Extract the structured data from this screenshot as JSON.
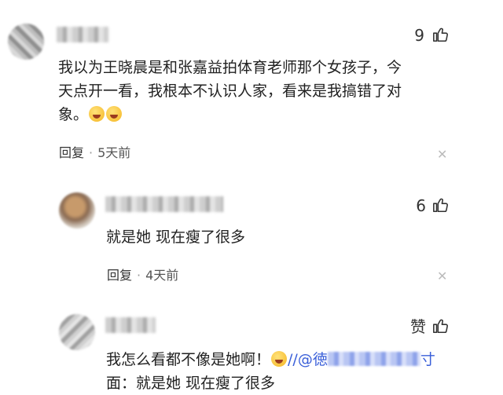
{
  "comments": [
    {
      "like_count": "9",
      "text_lines": [
        "我以为王晓晨是和张嘉益拍体育老师那个女孩子，今",
        "天点开一看，我根本不认识人家，看来是我搞错了对",
        "象。"
      ],
      "reply_label": "回复",
      "time": "5天前",
      "icons": [
        "grinning-squinting-face-icon",
        "grinning-squinting-face-icon",
        "thumbs-up-icon",
        "close-icon"
      ]
    },
    {
      "like_count": "6",
      "text": "就是她 现在瘦了很多",
      "reply_label": "回复",
      "time": "4天前",
      "icons": [
        "thumbs-up-icon",
        "close-icon"
      ]
    },
    {
      "like_label": "赞",
      "text_before": "我怎么看都不像是她啊！",
      "text_after_emoji": "//@",
      "mention_start": "徳",
      "mention_end": "寸",
      "quote_line": "面：就是她 现在瘦了很多",
      "icons": [
        "grinning-squinting-face-icon",
        "thumbs-up-icon"
      ]
    }
  ],
  "separator": "·",
  "colors": {
    "mention": "#3a5fd9",
    "text": "#222222",
    "meta": "#555555"
  }
}
